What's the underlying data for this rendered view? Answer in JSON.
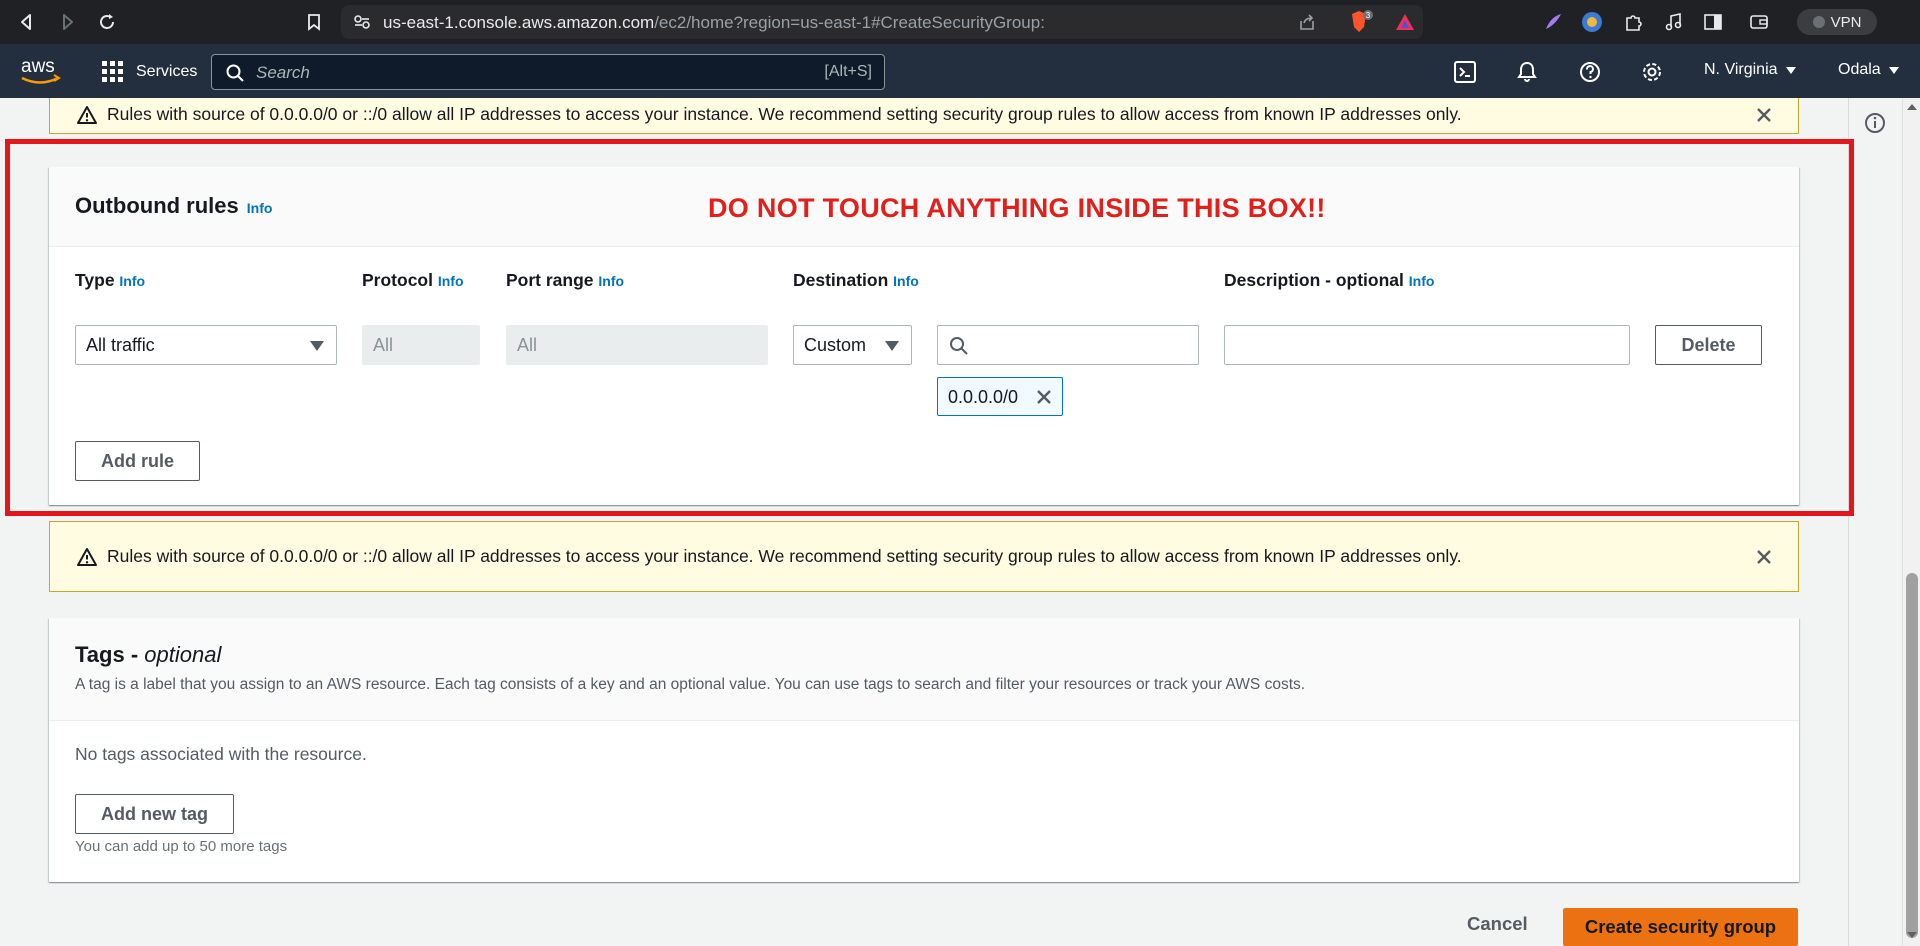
{
  "browser": {
    "url_host": "us-east-1.console.aws.amazon.com",
    "url_path": "/ec2/home?region=us-east-1#CreateSecurityGroup:",
    "shield_count": "3",
    "vpn_label": "VPN"
  },
  "aws_nav": {
    "logo_text": "aws",
    "services_label": "Services",
    "search_placeholder": "Search",
    "search_shortcut": "[Alt+S]",
    "region": "N. Virginia",
    "account": "Odala"
  },
  "warnings": {
    "text": "Rules with source of 0.0.0.0/0 or ::/0 allow all IP addresses to access your instance. We recommend setting security group rules to allow access from known IP addresses only."
  },
  "outbound": {
    "title": "Outbound rules",
    "info": "Info",
    "annotation": "DO NOT TOUCH ANYTHING INSIDE THIS BOX!!",
    "columns": {
      "type": "Type",
      "protocol": "Protocol",
      "port_range": "Port range",
      "destination": "Destination",
      "description": "Description - optional"
    },
    "rule": {
      "type": "All traffic",
      "protocol": "All",
      "port_range": "All",
      "destination_mode": "Custom",
      "destination_search": "",
      "destination_token": "0.0.0.0/0",
      "description": ""
    },
    "delete_label": "Delete",
    "add_rule_label": "Add rule"
  },
  "tags": {
    "title_main": "Tags - ",
    "title_optional": "optional",
    "description": "A tag is a label that you assign to an AWS resource. Each tag consists of a key and an optional value. You can use tags to search and filter your resources or track your AWS costs.",
    "empty": "No tags associated with the resource.",
    "add_label": "Add new tag",
    "limit": "You can add up to 50 more tags"
  },
  "footer": {
    "cancel_label": "Cancel",
    "create_label": "Create security group"
  },
  "colors": {
    "aws_nav": "#232f3e",
    "link": "#0073bb",
    "primary_button": "#ec7211",
    "warning_bg": "#fffce2",
    "annotation_red": "#e5151c"
  }
}
